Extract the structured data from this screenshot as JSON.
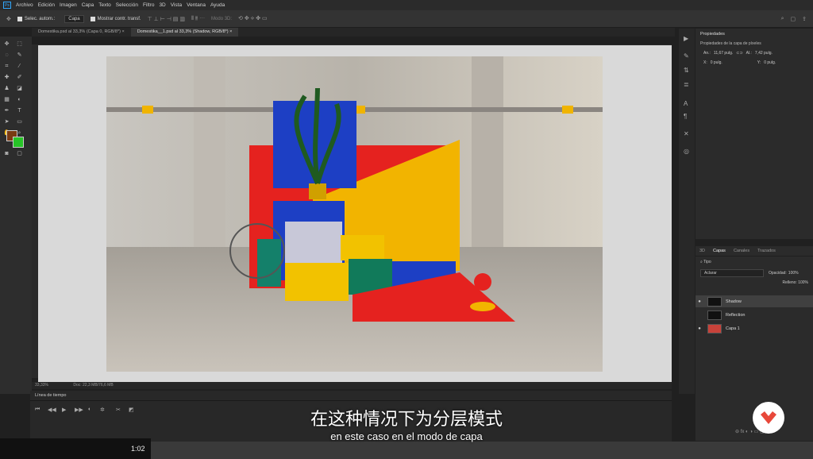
{
  "menu": {
    "items": [
      "Archivo",
      "Edición",
      "Imagen",
      "Capa",
      "Texto",
      "Selección",
      "Filtro",
      "3D",
      "Vista",
      "Ventana",
      "Ayuda"
    ]
  },
  "options": {
    "autosel": "Selec. autom.:",
    "capa": "Capa",
    "mostrar": "Mostrar contr. transf.",
    "modo3d": "Modo 3D:"
  },
  "tabs": [
    "Domestika.psd al 33,3% (Capa 0, RGB/8*)",
    "Domestika__1.psd al 33,3% (Shadow, RGB/8*)"
  ],
  "status": {
    "zoom": "33,33%",
    "doc": "Doc: 22,3 MB/76,6 MB"
  },
  "timeline": {
    "title": "Línea de tiempo"
  },
  "video": {
    "time": "1:02"
  },
  "properties": {
    "title": "Propiedades",
    "subtitle": "Propiedades de la capa de píxeles",
    "w_label": "An.:",
    "w_value": "11,67 pulg.",
    "h_label": "Al.:",
    "h_value": "7,42 pulg.",
    "x_label": "X:",
    "x_value": "0 pulg.",
    "y_label": "Y:",
    "y_value": "0 pulg."
  },
  "layers": {
    "tabs": [
      "3D",
      "Capas",
      "Canales",
      "Trazados"
    ],
    "filter": "Tipo",
    "blend": "Aclarar",
    "opacity_label": "Opacidad:",
    "opacity": "100%",
    "fill_label": "Relleno:",
    "fill": "100%",
    "items": [
      "Shadow",
      "Reflection",
      "Capa 1"
    ]
  },
  "subtitles": {
    "cn": "在这种情况下为分层模式",
    "es": "en este caso en el modo de capa"
  }
}
